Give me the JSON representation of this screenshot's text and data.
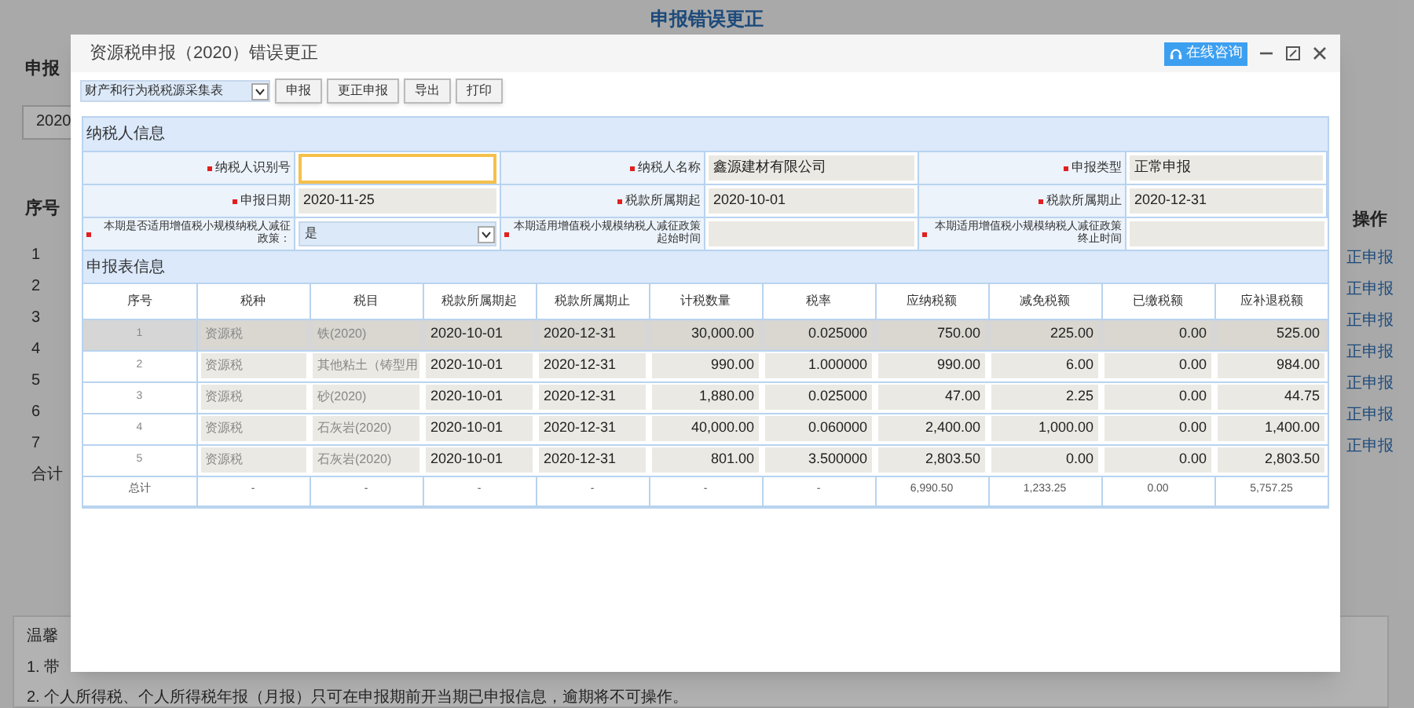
{
  "page": {
    "title": "申报错误更正",
    "filter_label": "申报",
    "filter_value": "2020",
    "list_header": "序号",
    "list_numbers": [
      "1",
      "2",
      "3",
      "4",
      "5",
      "6",
      "7"
    ],
    "list_total": "合计",
    "action_header": "操作",
    "actions": [
      "正申报",
      "正申报",
      "正申报",
      "正申报",
      "正申报",
      "正申报",
      "正申报"
    ],
    "notice_title": "温馨",
    "notice_lines": [
      "1. 带",
      "2. 个人所得税、个人所得税年报（月报）只可在申报期前开当期已申报信息，逾期将不可操作。"
    ]
  },
  "dialog": {
    "title": "资源税申报（2020）错误更正",
    "consult_button": "在线咨询",
    "toolbar": {
      "select_value": "财产和行为税税源采集表",
      "buttons": [
        "申报",
        "更正申报",
        "导出",
        "打印"
      ]
    },
    "taxpayer_section": {
      "title": "纳税人信息",
      "fields": [
        {
          "label": "纳税人识别号",
          "required": true,
          "kind": "input",
          "focused": true
        },
        {
          "label": "纳税人名称",
          "required": true,
          "kind": "text",
          "value": "鑫源建材有限公司"
        },
        {
          "label": "申报类型",
          "required": true,
          "kind": "text",
          "value": "正常申报"
        },
        {
          "label": "申报日期",
          "required": true,
          "kind": "text",
          "value": "2020-11-25"
        },
        {
          "label": "税款所属期起",
          "required": true,
          "kind": "text",
          "value": "2020-10-01"
        },
        {
          "label": "税款所属期止",
          "required": true,
          "kind": "text",
          "value": "2020-12-31"
        },
        {
          "label": "本期是否适用增值税小规模纳税人减征政策：",
          "required": true,
          "kind": "select",
          "value": "是"
        },
        {
          "label": "本期适用增值税小规模纳税人减征政策起始时间",
          "required": true,
          "kind": "text"
        },
        {
          "label": "本期适用增值税小规模纳税人减征政策终止时间",
          "required": true,
          "kind": "text"
        }
      ]
    },
    "report_section": {
      "title": "申报表信息",
      "columns": [
        {
          "label": "序号",
          "kind": "index"
        },
        {
          "label": "税种",
          "kind": "text"
        },
        {
          "label": "税目",
          "kind": "text"
        },
        {
          "label": "税款所属期起",
          "kind": "date"
        },
        {
          "label": "税款所属期止",
          "kind": "date"
        },
        {
          "label": "计税数量",
          "kind": "number"
        },
        {
          "label": "税率",
          "kind": "number"
        },
        {
          "label": "应纳税额",
          "kind": "number"
        },
        {
          "label": "减免税额",
          "kind": "number"
        },
        {
          "label": "已缴税额",
          "kind": "number"
        },
        {
          "label": "应补退税额",
          "kind": "number"
        }
      ],
      "rows": [
        {
          "selected": true,
          "cells": [
            "1",
            "资源税",
            "铁(2020)",
            "2020-10-01",
            "2020-12-31",
            "30,000.00",
            "0.025000",
            "750.00",
            "225.00",
            "0.00",
            "525.00"
          ]
        },
        {
          "selected": false,
          "cells": [
            "2",
            "资源税",
            "其他粘土（铸型用",
            "2020-10-01",
            "2020-12-31",
            "990.00",
            "1.000000",
            "990.00",
            "6.00",
            "0.00",
            "984.00"
          ]
        },
        {
          "selected": false,
          "cells": [
            "3",
            "资源税",
            "砂(2020)",
            "2020-10-01",
            "2020-12-31",
            "1,880.00",
            "0.025000",
            "47.00",
            "2.25",
            "0.00",
            "44.75"
          ]
        },
        {
          "selected": false,
          "cells": [
            "4",
            "资源税",
            "石灰岩(2020)",
            "2020-10-01",
            "2020-12-31",
            "40,000.00",
            "0.060000",
            "2,400.00",
            "1,000.00",
            "0.00",
            "1,400.00"
          ]
        },
        {
          "selected": false,
          "cells": [
            "5",
            "资源税",
            "石灰岩(2020)",
            "2020-10-01",
            "2020-12-31",
            "801.00",
            "3.500000",
            "2,803.50",
            "0.00",
            "0.00",
            "2,803.50"
          ]
        }
      ],
      "total": [
        "总计",
        "-",
        "-",
        "-",
        "-",
        "-",
        "-",
        "6,990.50",
        "1,233.25",
        "0.00",
        "5,757.25"
      ]
    }
  }
}
